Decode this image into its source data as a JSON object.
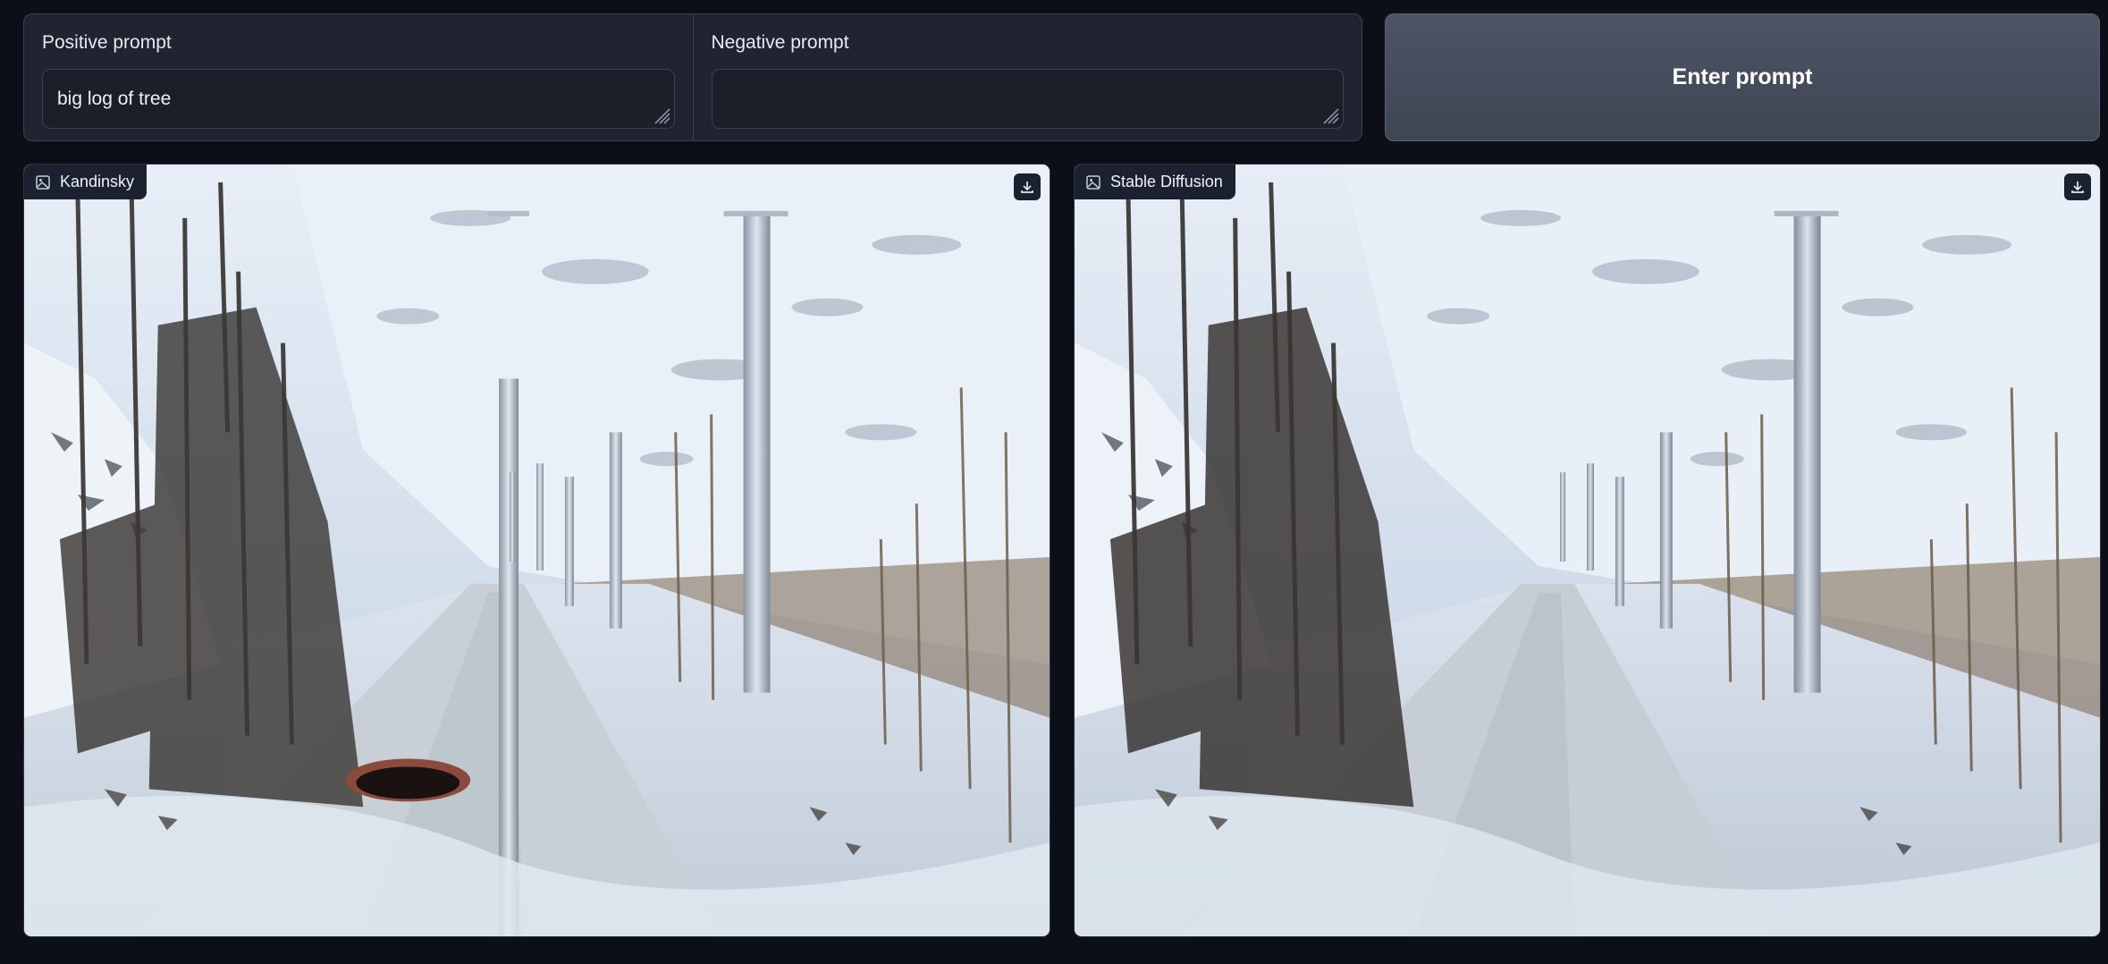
{
  "prompts": {
    "positive": {
      "label": "Positive prompt",
      "value": "big log of tree",
      "placeholder": ""
    },
    "negative": {
      "label": "Negative prompt",
      "value": "",
      "placeholder": ""
    }
  },
  "submit": {
    "label": "Enter prompt"
  },
  "outputs": [
    {
      "label": "Kandinsky",
      "icon": "image-icon",
      "action_icon": "download-icon"
    },
    {
      "label": "Stable Diffusion",
      "icon": "image-icon",
      "action_icon": "download-icon"
    }
  ],
  "colors": {
    "background": "#0c0f17",
    "panel": "#1f2430",
    "button": "#474e5d",
    "label_chip": "#1c2130"
  }
}
